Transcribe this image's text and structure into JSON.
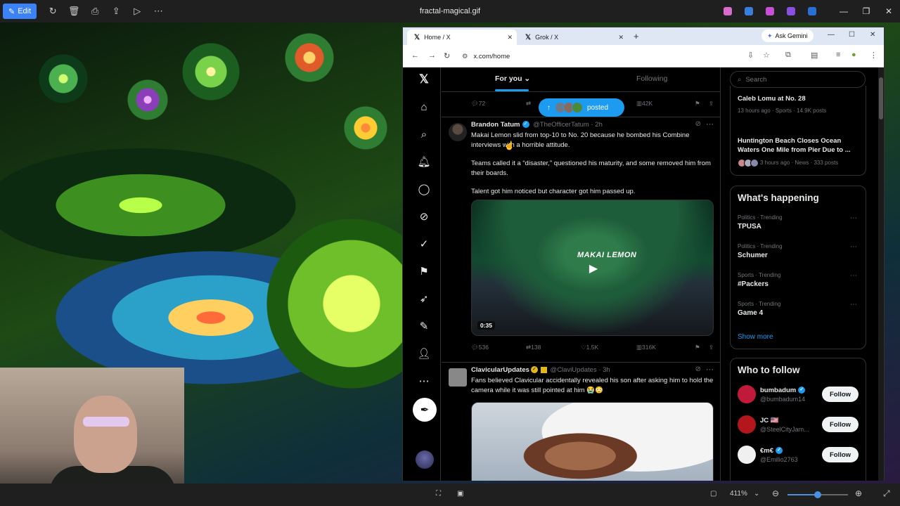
{
  "viewer": {
    "edit_label": "Edit",
    "filename": "fractal-magical.gif",
    "zoom": "411%",
    "zoom_fraction": 0.5
  },
  "browser": {
    "tabs": [
      {
        "title": "Home / X"
      },
      {
        "title": "Grok / X"
      }
    ],
    "gemini_label": "Ask Gemini",
    "url": "x.com/home"
  },
  "feed": {
    "tab_for_you": "For you",
    "tab_following": "Following",
    "posted_label": "posted",
    "top_actions": {
      "replies": "72",
      "views": "42K"
    },
    "tweets": [
      {
        "name": "Brandon Tatum",
        "handle": "@TheOfficerTatum",
        "time": "· 2h",
        "p1": "Makai Lemon slid from top-10 to No. 20 because he bombed his Combine interviews with a horrible attitude.",
        "p2": "Teams called it a “disaster,” questioned his maturity, and some removed him from their boards.",
        "p3": "Talent got him noticed but character got him passed up.",
        "video_text": "MAKAI LEMON",
        "duration": "0:35",
        "replies": "536",
        "reposts": "138",
        "likes": "1.5K",
        "views": "316K"
      },
      {
        "name": "ClavicularUpdates",
        "handle": "@ClaviUpdates",
        "time": "· 3h",
        "p1": "Fans believed Clavicular accidentally revealed his son after asking him to hold the camera while it was still pointed at him 😭😳"
      }
    ]
  },
  "sidebar": {
    "search_placeholder": "Search",
    "news": [
      {
        "title": "Caleb Lomu at No. 28",
        "meta": "13 hours ago · Sports · 14.9K posts"
      },
      {
        "title": "Huntington Beach Closes Ocean Waters One Mile from Pier Due to ...",
        "meta": "3 hours ago · News · 333 posts"
      }
    ],
    "whats_happening_title": "What's happening",
    "trends": [
      {
        "meta": "Politics · Trending",
        "name": "TPUSA"
      },
      {
        "meta": "Politics · Trending",
        "name": "Schumer"
      },
      {
        "meta": "Sports · Trending",
        "name": "#Packers"
      },
      {
        "meta": "Sports · Trending",
        "name": "Game 4"
      }
    ],
    "show_more": "Show more",
    "who_to_follow_title": "Who to follow",
    "follow_label": "Follow",
    "suggestions": [
      {
        "name": "bumbadum",
        "handle": "@bumbadum14",
        "color": "#c0193a"
      },
      {
        "name": "JC 🇺🇸",
        "handle": "@SteelCityJam...",
        "color": "#b3161b"
      },
      {
        "name": "€m€",
        "handle": "@Emilio2763",
        "color": "#f0f0f0"
      }
    ]
  },
  "colors": {
    "accent": "#1d9bf0",
    "edit_button": "#3b82f6"
  }
}
